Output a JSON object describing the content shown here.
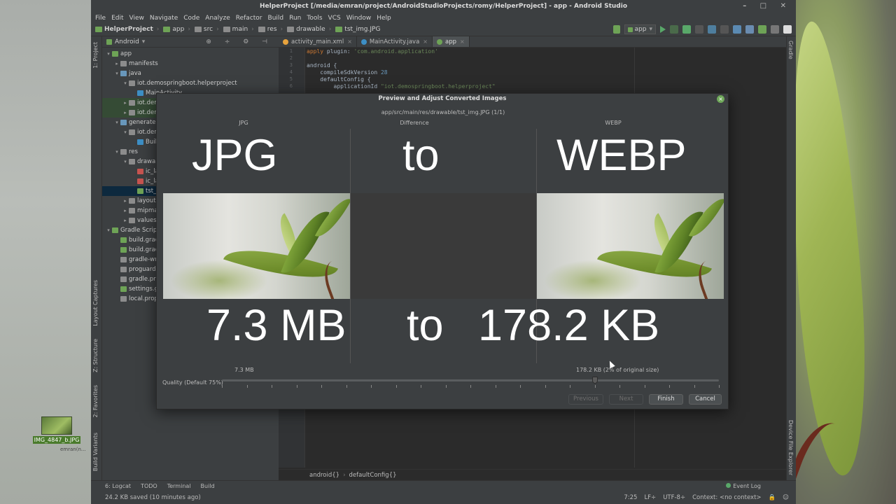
{
  "window": {
    "title": "HelperProject [/media/emran/project/AndroidStudioProjects/romy/HelperProject] - app - Android Studio",
    "controls": "– □ ✕"
  },
  "menu": [
    "File",
    "Edit",
    "View",
    "Navigate",
    "Code",
    "Analyze",
    "Refactor",
    "Build",
    "Run",
    "Tools",
    "VCS",
    "Window",
    "Help"
  ],
  "breadcrumbs": [
    "HelperProject",
    "app",
    "src",
    "main",
    "res",
    "drawable",
    "tst_img.JPG"
  ],
  "toolbar": {
    "run_config": "app"
  },
  "left_tabs": {
    "project": "1: Project",
    "layout_captures": "Layout Captures",
    "structure": "Z: Structure",
    "favorites": "2: Favorites",
    "build_variants": "Build Variants"
  },
  "right_tabs": {
    "gradle": "Gradle",
    "device_explorer": "Device File Explorer"
  },
  "project_panel": {
    "view_mode": "Android",
    "tree": [
      {
        "label": "app",
        "indent": 0,
        "arrow": "▾",
        "color": "#6ea356"
      },
      {
        "label": "manifests",
        "indent": 1,
        "arrow": "▸",
        "color": "#8c8c8c"
      },
      {
        "label": "java",
        "indent": 1,
        "arrow": "▾",
        "color": "#6897bb"
      },
      {
        "label": "iot.demospringboot.helperproject",
        "indent": 2,
        "arrow": "▾",
        "color": "#8c8c8c"
      },
      {
        "label": "MainActivity",
        "indent": 3,
        "arrow": "",
        "color": "#3d8fc5"
      },
      {
        "label": "iot.demospringboot.helperproject (androidTest)",
        "indent": 2,
        "arrow": "▸",
        "color": "#8c8c8c",
        "hl": true
      },
      {
        "label": "iot.demospringboot.helperproject (test)",
        "indent": 2,
        "arrow": "▸",
        "color": "#8c8c8c",
        "hl": true
      },
      {
        "label": "generatedJava",
        "indent": 1,
        "arrow": "▾",
        "color": "#6897bb"
      },
      {
        "label": "iot.demospringboot.helperproject",
        "indent": 2,
        "arrow": "▾",
        "color": "#8c8c8c"
      },
      {
        "label": "BuildConfig",
        "indent": 3,
        "arrow": "",
        "color": "#3d8fc5"
      },
      {
        "label": "res",
        "indent": 1,
        "arrow": "▾",
        "color": "#8c8c8c"
      },
      {
        "label": "drawable",
        "indent": 2,
        "arrow": "▾",
        "color": "#8c8c8c"
      },
      {
        "label": "ic_launcher_background.xml",
        "indent": 3,
        "arrow": "",
        "color": "#c75450"
      },
      {
        "label": "ic_launcher_foreground.xml",
        "indent": 3,
        "arrow": "",
        "color": "#c75450"
      },
      {
        "label": "tst_img.JPG",
        "indent": 3,
        "arrow": "",
        "color": "#6ea356",
        "sel": true
      },
      {
        "label": "layout",
        "indent": 2,
        "arrow": "▸",
        "color": "#8c8c8c"
      },
      {
        "label": "mipmap",
        "indent": 2,
        "arrow": "▸",
        "color": "#8c8c8c"
      },
      {
        "label": "values",
        "indent": 2,
        "arrow": "▸",
        "color": "#8c8c8c"
      },
      {
        "label": "Gradle Scripts",
        "indent": 0,
        "arrow": "▾",
        "color": "#6ea356"
      },
      {
        "label": "build.gradle (Project: HelperProject)",
        "indent": 1,
        "arrow": "",
        "color": "#6ea356"
      },
      {
        "label": "build.gradle (Module: app)",
        "indent": 1,
        "arrow": "",
        "color": "#6ea356"
      },
      {
        "label": "gradle-wrapper.properties",
        "indent": 1,
        "arrow": "",
        "color": "#8c8c8c"
      },
      {
        "label": "proguard-rules.pro",
        "indent": 1,
        "arrow": "",
        "color": "#8c8c8c"
      },
      {
        "label": "gradle.properties",
        "indent": 1,
        "arrow": "",
        "color": "#8c8c8c"
      },
      {
        "label": "settings.gradle",
        "indent": 1,
        "arrow": "",
        "color": "#6ea356"
      },
      {
        "label": "local.properties",
        "indent": 1,
        "arrow": "",
        "color": "#8c8c8c"
      }
    ]
  },
  "editor": {
    "tabs": [
      {
        "label": "activity_main.xml",
        "color": "#e8a33d",
        "active": false
      },
      {
        "label": "MainActivity.java",
        "color": "#3d8fc5",
        "active": false
      },
      {
        "label": "app",
        "color": "#6ea356",
        "active": true
      }
    ],
    "code_lines": [
      {
        "n": "1",
        "html": "<span class=\"kw\">apply</span> plugin: <span class=\"str\">'com.android.application'</span>"
      },
      {
        "n": "2",
        "html": ""
      },
      {
        "n": "3",
        "html": "android {"
      },
      {
        "n": "4",
        "html": "    compileSdkVersion <span class=\"num\">28</span>"
      },
      {
        "n": "5",
        "html": "    defaultConfig {"
      },
      {
        "n": "6",
        "html": "        applicationId <span class=\"str\">\"iot.demospringboot.helperproject\"</span>"
      }
    ],
    "breadcrumb": [
      "android{}",
      "defaultConfig{}"
    ]
  },
  "dialog": {
    "title": "Preview and Adjust Converted Images",
    "path": "app/src/main/res/drawable/tst_img.JPG (1/1)",
    "columns": [
      "JPG",
      "Difference",
      "WEBP"
    ],
    "overlay": {
      "jpg": "JPG",
      "to1": "to",
      "webp": "WEBP",
      "mb": "7.3 MB",
      "to2": "to",
      "kb": "178.2 KB"
    },
    "original_size": "7.3 MB",
    "converted_size": "178.2 KB (2% of original size)",
    "quality_label": "Quality (Default 75%)",
    "quality_value": 75,
    "buttons": {
      "previous": "Previous",
      "next": "Next",
      "finish": "Finish",
      "cancel": "Cancel"
    }
  },
  "bottom_tools": [
    "6: Logcat",
    "TODO",
    "Terminal",
    "Build"
  ],
  "event_log": "Event Log",
  "status": {
    "message": "24.2 KB saved (10 minutes ago)",
    "position": "7:25",
    "line_sep": "LF÷",
    "encoding": "UTF-8÷",
    "context": "Context: <no context>"
  },
  "desktop": {
    "file_name": "IMG_4847_b.JPG",
    "file_sub": "emran(n..."
  }
}
